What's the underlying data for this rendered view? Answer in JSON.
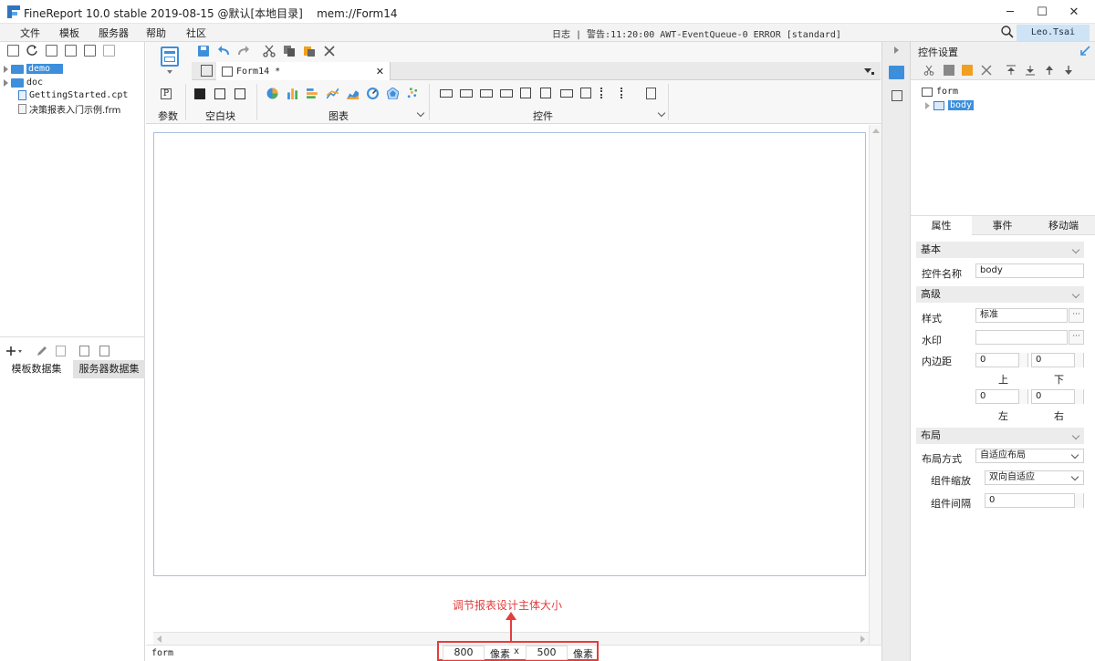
{
  "titlebar": {
    "title": "FineReport 10.0 stable 2019-08-15 @默认[本地目录]    mem://Form14",
    "minimize": "─",
    "maximize": "☐",
    "close": "✕"
  },
  "menu": [
    "文件",
    "模板",
    "服务器",
    "帮助",
    "社区"
  ],
  "status_text": "日志 | 警告:11:20:00 AWT-EventQueue-0 ERROR [standard]",
  "user": "Leo.Tsai",
  "left_tree": [
    {
      "label": "demo",
      "type": "folder",
      "selected": true
    },
    {
      "label": "doc",
      "type": "folder",
      "selected": false
    },
    {
      "label": "GettingStarted.cpt",
      "type": "file"
    },
    {
      "label": "决策报表入门示例.frm",
      "type": "file"
    }
  ],
  "datasets": {
    "tab1": "模板数据集",
    "tab2": "服务器数据集"
  },
  "doc_tab": "Form14 *",
  "groups": {
    "params": "参数",
    "blank": "空白块",
    "chart": "图表",
    "widget": "控件"
  },
  "param_letter": "P",
  "canvas_status": "form",
  "size": {
    "width": "800",
    "unit1": "像素",
    "x": "x",
    "height": "500",
    "unit2": "像素"
  },
  "annotation": "调节报表设计主体大小",
  "right": {
    "header": "控件设置",
    "tree_root": "form",
    "tree_child": "body",
    "tabs": [
      "属性",
      "事件",
      "移动端"
    ],
    "basic": "基本",
    "widget_name_label": "控件名称",
    "widget_name_value": "body",
    "advanced": "高级",
    "style_label": "样式",
    "style_value": "标准",
    "watermark_label": "水印",
    "padding_label": "内边距",
    "pad_top": "0",
    "pad_bottom": "0",
    "pad_left": "0",
    "pad_right": "0",
    "top": "上",
    "bottom": "下",
    "left": "左",
    "right_lbl": "右",
    "layout": "布局",
    "layout_mode_label": "布局方式",
    "layout_mode_value": "自适应布局",
    "scale_label": "组件缩放",
    "scale_value": "双向自适应",
    "gap_label": "组件间隔",
    "gap_value": "0"
  },
  "colors": {
    "accent": "#3d8fdc",
    "annotation": "#e43d3d"
  }
}
